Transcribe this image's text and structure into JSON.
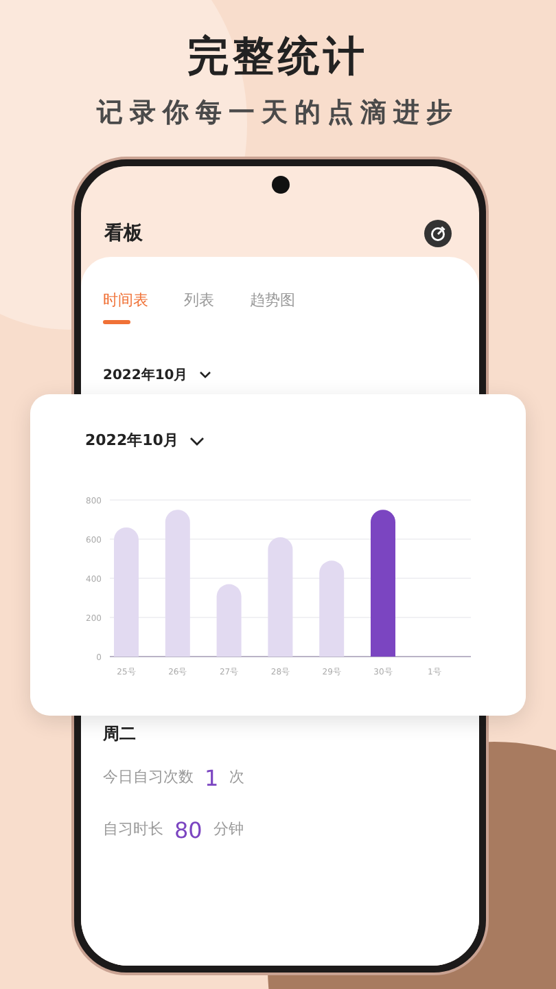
{
  "headline": "完整统计",
  "subtitle": "记录你每一天的点滴进步",
  "app": {
    "title": "看板",
    "tabs": [
      {
        "label": "时间表",
        "selected": true
      },
      {
        "label": "列表",
        "selected": false
      },
      {
        "label": "趋势图",
        "selected": false
      }
    ],
    "month": "2022年10月"
  },
  "chart_card": {
    "month": "2022年10月",
    "chart_data": {
      "type": "bar",
      "categories": [
        "25号",
        "26号",
        "27号",
        "28号",
        "29号",
        "30号",
        "1号"
      ],
      "grid": true,
      "ylim": [
        0,
        800
      ],
      "yticks": [
        0,
        200,
        400,
        600,
        800
      ],
      "series": [
        {
          "color": "#e2daf1",
          "values": [
            660,
            750,
            370,
            610,
            490,
            null,
            null
          ]
        },
        {
          "color": "#7b45c1",
          "values": [
            null,
            null,
            null,
            null,
            null,
            750,
            null
          ]
        }
      ]
    }
  },
  "day": {
    "weekday": "周二",
    "stats": [
      {
        "label": "今日自习次数",
        "value": "1",
        "unit": "次"
      },
      {
        "label": "自习时长",
        "value": "80",
        "unit": "分钟"
      }
    ]
  }
}
